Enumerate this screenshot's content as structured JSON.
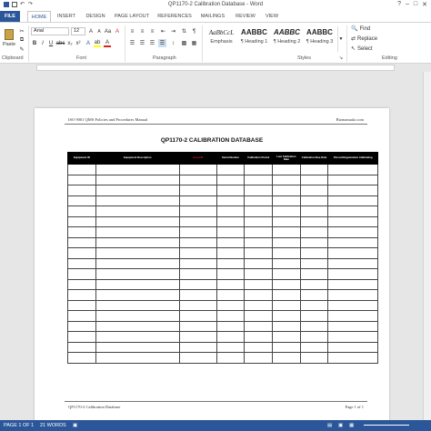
{
  "window": {
    "title": "QP1170-2 Calibration Database - Word"
  },
  "tabs": [
    {
      "label": "FILE"
    },
    {
      "label": "HOME"
    },
    {
      "label": "INSERT"
    },
    {
      "label": "DESIGN"
    },
    {
      "label": "PAGE LAYOUT"
    },
    {
      "label": "REFERENCES"
    },
    {
      "label": "MAILINGS"
    },
    {
      "label": "REVIEW"
    },
    {
      "label": "VIEW"
    }
  ],
  "ribbon": {
    "clipboard": {
      "paste_label": "Paste",
      "group_label": "Clipboard"
    },
    "font": {
      "name": "Arial",
      "size": "12",
      "group_label": "Font"
    },
    "paragraph": {
      "group_label": "Paragraph"
    },
    "styles": {
      "group_label": "Styles",
      "items": [
        {
          "sample": "AaBbCcL",
          "name": "Emphasis"
        },
        {
          "sample": "AABBC",
          "name": "¶ Heading 1"
        },
        {
          "sample": "AABBC",
          "name": "¶ Heading 2"
        },
        {
          "sample": "AABBC",
          "name": "¶ Heading 3"
        }
      ]
    },
    "editing": {
      "find": "Find",
      "replace": "Replace",
      "select": "Select",
      "group_label": "Editing"
    }
  },
  "document": {
    "header_left": "ISO 9001 QMS Policies and Procedures Manual",
    "header_right": "Bizmanualz.com",
    "title": "QP1170-2 CALIBRATION DATABASE",
    "columns": [
      "Equipment ID",
      "Equipment Description",
      "Asset ID",
      "Serial Number",
      "Calibration Period",
      "Last Calibration Date",
      "Calibration Due Date",
      "Person/Organization Calibrating"
    ],
    "row_count": 19,
    "footer_left": "QP1170-2 Calibration Database",
    "footer_right": "Page 1 of 1"
  },
  "status": {
    "page": "PAGE 1 OF 1",
    "words": "21 WORDS"
  },
  "colors": {
    "accent": "#2b579a",
    "header_fill": "#000000",
    "asset_text": "#e02020"
  }
}
